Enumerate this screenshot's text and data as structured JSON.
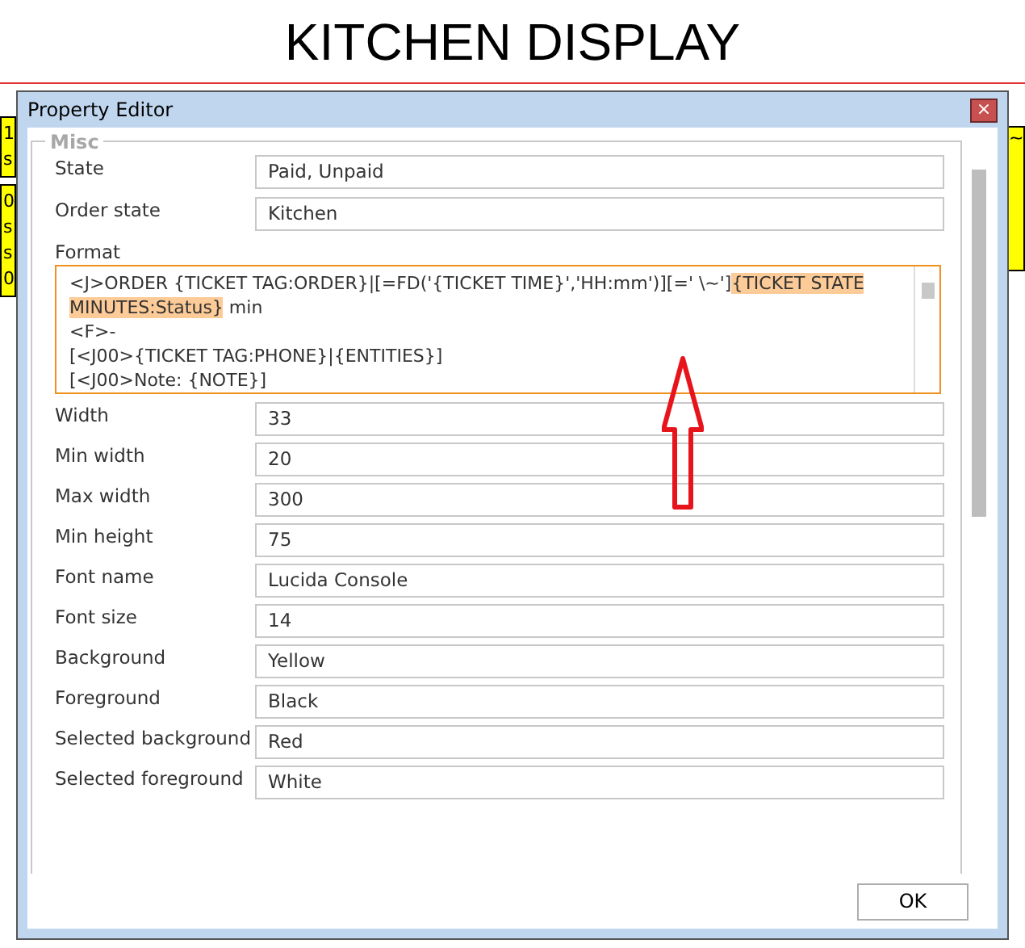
{
  "page_title": "KITCHEN DISPLAY",
  "background_cards": [
    {
      "lines": [
        "1",
        "s"
      ]
    },
    {
      "lines": [
        "0",
        "s",
        "s",
        "0"
      ]
    }
  ],
  "right_card": {
    "lines": [
      "~"
    ]
  },
  "dialog": {
    "title": "Property Editor",
    "close": "×"
  },
  "group": {
    "title": "Misc"
  },
  "fields_top": [
    {
      "label": "State",
      "value": "Paid, Unpaid"
    },
    {
      "label": "Order state",
      "value": "Kitchen"
    }
  ],
  "format": {
    "label": "Format",
    "lines": [
      [
        {
          "text": "<J>ORDER  {TICKET TAG:ORDER}|[=FD('{TICKET TIME}','HH:mm')][=' \\~']",
          "highlighted": false
        },
        {
          "text": "{TICKET STATE MINUTES:Status}",
          "highlighted": true
        },
        {
          "text": " min",
          "highlighted": false
        }
      ],
      [
        {
          "text": "<F>-",
          "highlighted": false
        }
      ],
      [
        {
          "text": "[<J00>{TICKET TAG:PHONE}|{ENTITIES}]",
          "highlighted": false
        }
      ],
      [
        {
          "text": "[<J00>Note: {NOTE}]",
          "highlighted": false
        }
      ]
    ]
  },
  "fields": [
    {
      "label": "Width",
      "value": "33"
    },
    {
      "label": "Min width",
      "value": "20"
    },
    {
      "label": "Max width",
      "value": "300"
    },
    {
      "label": "Min height",
      "value": "75"
    },
    {
      "label": "Font name",
      "value": "Lucida Console"
    },
    {
      "label": "Font size",
      "value": "14"
    },
    {
      "label": "Background",
      "value": "Yellow"
    },
    {
      "label": "Foreground",
      "value": "Black"
    },
    {
      "label": "Selected background",
      "value": "Red"
    },
    {
      "label": "Selected foreground",
      "value": "White"
    }
  ],
  "ok_button": "OK"
}
